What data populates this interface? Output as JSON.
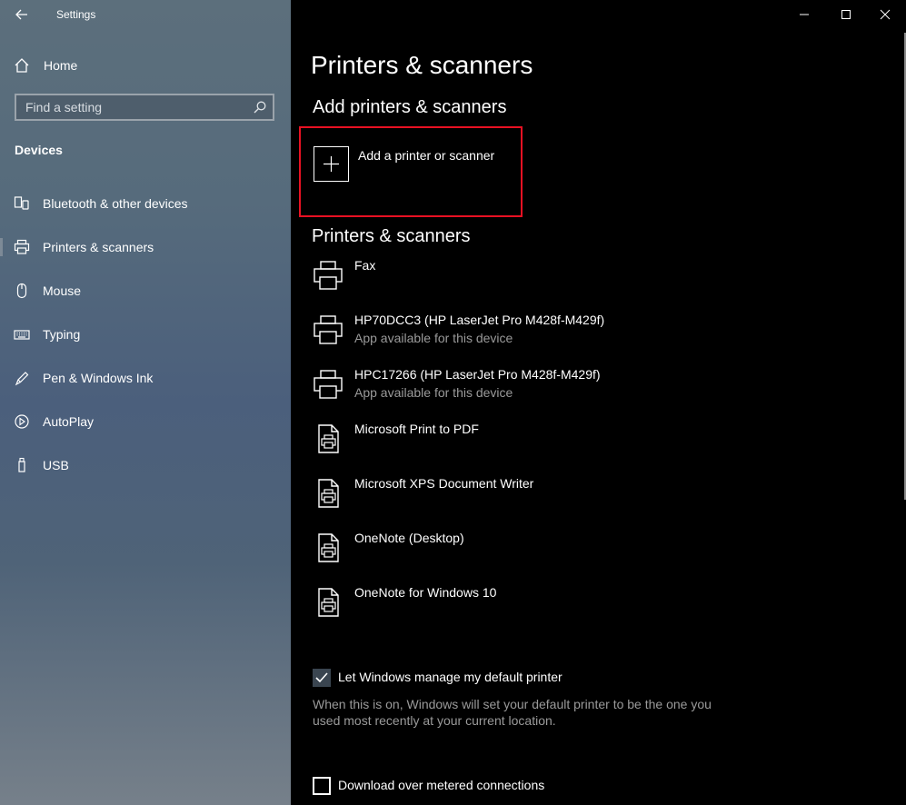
{
  "window": {
    "title": "Settings"
  },
  "sidebar": {
    "home_label": "Home",
    "search": {
      "placeholder": "Find a setting"
    },
    "section_heading": "Devices",
    "items": [
      {
        "label": "Bluetooth & other devices",
        "icon": "bluetooth-icon"
      },
      {
        "label": "Printers & scanners",
        "icon": "printer-icon",
        "selected": true
      },
      {
        "label": "Mouse",
        "icon": "mouse-icon"
      },
      {
        "label": "Typing",
        "icon": "keyboard-icon"
      },
      {
        "label": "Pen & Windows Ink",
        "icon": "pen-icon"
      },
      {
        "label": "AutoPlay",
        "icon": "autoplay-icon"
      },
      {
        "label": "USB",
        "icon": "usb-icon"
      }
    ]
  },
  "main": {
    "title": "Printers & scanners",
    "add_section": {
      "heading": "Add printers & scanners",
      "button_label": "Add a printer or scanner"
    },
    "list_section": {
      "heading": "Printers & scanners",
      "printers": [
        {
          "name": "Fax",
          "subtitle": "",
          "icon": "printer-icon"
        },
        {
          "name": "HP70DCC3 (HP LaserJet Pro M428f-M429f)",
          "subtitle": "App available for this device",
          "icon": "printer-icon"
        },
        {
          "name": "HPC17266 (HP LaserJet Pro M428f-M429f)",
          "subtitle": "App available for this device",
          "icon": "printer-icon"
        },
        {
          "name": "Microsoft Print to PDF",
          "subtitle": "",
          "icon": "document-printer-icon"
        },
        {
          "name": "Microsoft XPS Document Writer",
          "subtitle": "",
          "icon": "document-printer-icon"
        },
        {
          "name": "OneNote (Desktop)",
          "subtitle": "",
          "icon": "document-printer-icon"
        },
        {
          "name": "OneNote for Windows 10",
          "subtitle": "",
          "icon": "document-printer-icon"
        }
      ]
    },
    "manage_default": {
      "label": "Let Windows manage my default printer",
      "checked": true,
      "description": "When this is on, Windows will set your default printer to be the one you used most recently at your current location."
    },
    "metered": {
      "label": "Download over metered connections",
      "checked": false
    }
  },
  "colors": {
    "highlight_border": "#e81123",
    "checkbox_checked_bg": "#3a4550"
  }
}
